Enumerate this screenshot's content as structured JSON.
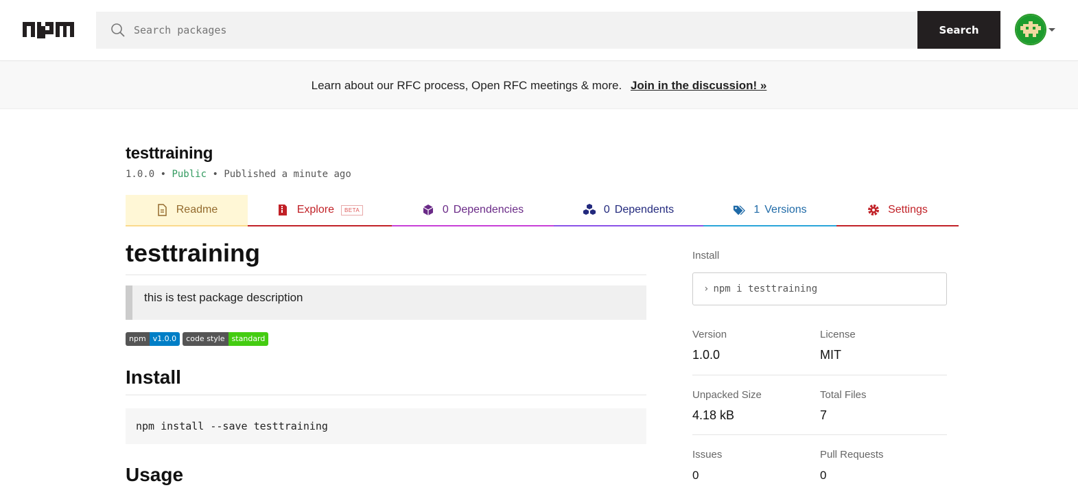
{
  "header": {
    "search_placeholder": "Search packages",
    "search_button": "Search"
  },
  "banner": {
    "text": "Learn about our RFC process, Open RFC meetings & more.",
    "link": "Join in the discussion! »"
  },
  "package": {
    "name": "testtraining",
    "version": "1.0.0",
    "sep": " • ",
    "visibility": "Public",
    "published": "Published a minute ago"
  },
  "tabs": {
    "readme": "Readme",
    "explore": "Explore",
    "beta": "BETA",
    "dependencies_count": "0",
    "dependencies": "Dependencies",
    "dependents_count": "0",
    "dependents": "Dependents",
    "versions_count": "1",
    "versions": "Versions",
    "settings": "Settings"
  },
  "readme": {
    "title": "testtraining",
    "description": "this is test package description",
    "badges": [
      {
        "left": "npm",
        "right": "v1.0.0"
      },
      {
        "left": "code style",
        "right": "standard"
      }
    ],
    "install_heading": "Install",
    "install_code": "npm install --save testtraining",
    "usage_heading": "Usage"
  },
  "sidebar": {
    "install_label": "Install",
    "install_cmd": "npm i testtraining",
    "version_label": "Version",
    "version": "1.0.0",
    "license_label": "License",
    "license": "MIT",
    "unpacked_label": "Unpacked Size",
    "unpacked": "4.18 kB",
    "files_label": "Total Files",
    "files": "7",
    "issues_label": "Issues",
    "issues": "0",
    "prs_label": "Pull Requests",
    "prs": "0"
  },
  "colors": {
    "explore": "#c12127",
    "dependencies": "#6a2a87",
    "dependents": "#22297d",
    "versions": "#1f6aa7",
    "public": "#329a5f"
  }
}
